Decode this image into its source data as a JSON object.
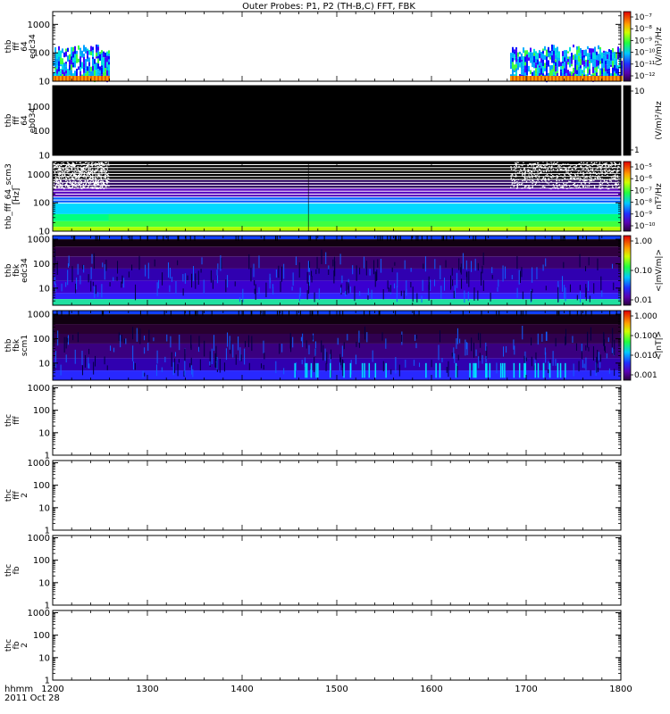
{
  "title": "Outer Probes: P1, P2 (TH-B,C) FFT, FBK",
  "x_axis": {
    "ticks": [
      "1200",
      "1300",
      "1400",
      "1500",
      "1600",
      "1700",
      "1800"
    ],
    "row1": "hhmm",
    "row2": "2011 Oct 28"
  },
  "chart_data": [
    {
      "type": "heatmap",
      "ylabel_lines": [
        "thb",
        "fff",
        "64",
        "edc34"
      ],
      "yticks": [
        "10",
        "100",
        "1000"
      ],
      "ylog": [
        1,
        3.45
      ],
      "colorbar": {
        "unit": "(V/m)²/Hz",
        "ticks": [
          "10⁻⁷",
          "10⁻⁸",
          "10⁻⁹",
          "10⁻¹⁰",
          "10⁻¹¹",
          "10⁻¹²"
        ]
      },
      "data_intervals": [
        [
          1200,
          1259
        ],
        [
          1683,
          1800
        ]
      ]
    },
    {
      "type": "heatmap",
      "ylabel_lines": [
        "thb",
        "fff",
        "64",
        "eb034"
      ],
      "yticks": [
        "10",
        "100",
        "1000"
      ],
      "ylog": [
        1,
        3.85
      ],
      "colorbar": {
        "unit": "(V/m)²/Hz",
        "ticks": [
          "10",
          "1"
        ]
      },
      "fill": "black"
    },
    {
      "type": "heatmap",
      "ylabel_lines": [
        "thb_fff_64_scm3",
        "[Hz]"
      ],
      "yticks": [
        "10",
        "100",
        "1000"
      ],
      "ylog": [
        1,
        3.45
      ],
      "colorbar": {
        "unit": "nT²/Hz",
        "ticks": [
          "10⁻⁵",
          "10⁻⁶",
          "10⁻⁷",
          "10⁻⁸",
          "10⁻⁹",
          "10⁻¹⁰"
        ]
      },
      "gap_interval": [
        1259,
        1683
      ],
      "change_time": 1470
    },
    {
      "type": "heatmap",
      "ylabel_lines": [
        "thb",
        "fbk",
        "edc34"
      ],
      "yticks": [
        "10",
        "100",
        "1000"
      ],
      "ylog": [
        0.3,
        3.15
      ],
      "colorbar": {
        "unit": "<|mV/m|>",
        "ticks": [
          "1.00",
          "0.10",
          "0.01"
        ]
      }
    },
    {
      "type": "heatmap",
      "ylabel_lines": [
        "thb",
        "fbk",
        "scm1"
      ],
      "yticks": [
        "10",
        "100",
        "1000"
      ],
      "ylog": [
        0.3,
        3.15
      ],
      "colorbar": {
        "unit": "<|nT|>",
        "ticks": [
          "1.000",
          "0.100",
          "0.010",
          "0.001"
        ]
      }
    },
    {
      "type": "heatmap",
      "ylabel_lines": [
        "thc",
        "fff"
      ],
      "yticks": [
        "1",
        "10",
        "100",
        "1000"
      ],
      "ylog": [
        0,
        3.1
      ]
    },
    {
      "type": "heatmap",
      "ylabel_lines": [
        "thc",
        "fff",
        "2"
      ],
      "yticks": [
        "1",
        "10",
        "100",
        "1000"
      ],
      "ylog": [
        0,
        3.1
      ]
    },
    {
      "type": "heatmap",
      "ylabel_lines": [
        "thc",
        "fb"
      ],
      "yticks": [
        "1",
        "10",
        "100",
        "1000"
      ],
      "ylog": [
        0,
        3.1
      ]
    },
    {
      "type": "heatmap",
      "ylabel_lines": [
        "thc",
        "fb",
        "2"
      ],
      "yticks": [
        "1",
        "10",
        "100",
        "1000"
      ],
      "ylog": [
        0,
        3.1
      ]
    }
  ]
}
